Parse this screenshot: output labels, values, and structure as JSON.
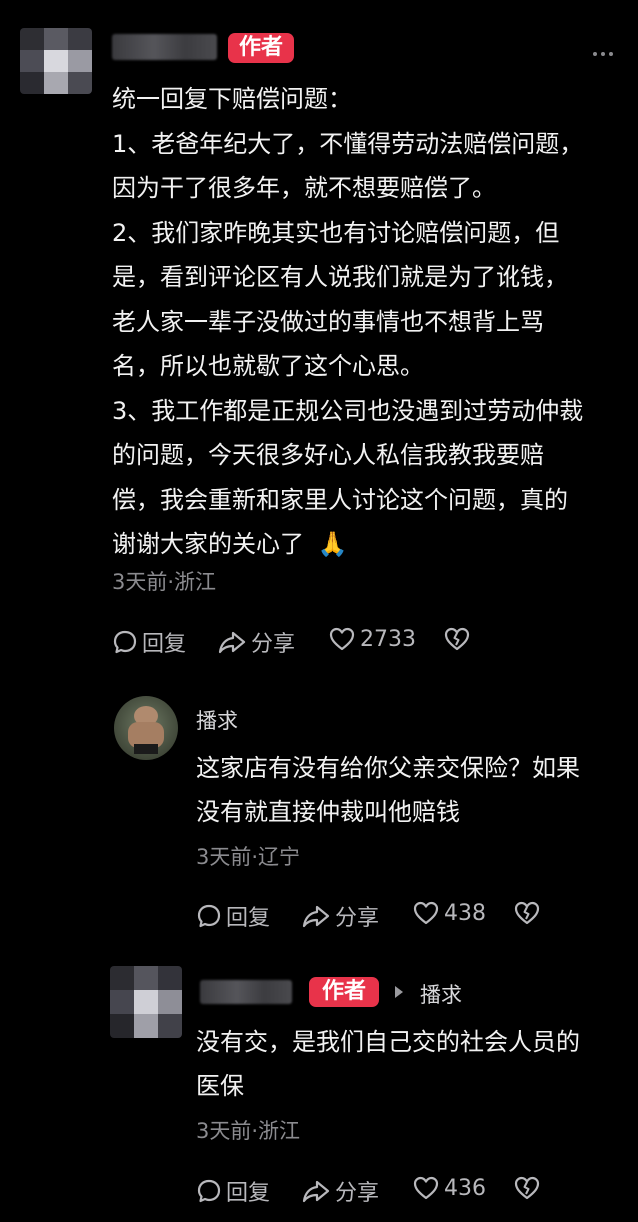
{
  "comment": {
    "author_badge": "作者",
    "lines": [
      "统一回复下赔偿问题：",
      "1、老爸年纪大了，不懂得劳动法赔偿问题，",
      "因为干了很多年，就不想要赔偿了。",
      "2、我们家昨晚其实也有讨论赔偿问题，但",
      "是，看到评论区有人说我们就是为了讹钱，",
      "老人家一辈子没做过的事情也不想背上骂",
      "名，所以也就歇了这个心思。",
      "3、我工作都是正规公司也没遇到过劳动仲裁",
      "的问题，今天很多好心人私信我教我要赔",
      "偿，我会重新和家里人讨论这个问题，真的",
      "谢谢大家的关心了"
    ],
    "emoji": "🙏",
    "meta": "3天前·浙江",
    "reply_label": "回复",
    "share_label": "分享",
    "like_count": "2733"
  },
  "replies": [
    {
      "name": "播求",
      "lines": [
        "这家店有没有给你父亲交保险？如果",
        "没有就直接仲裁叫他赔钱"
      ],
      "meta": "3天前·辽宁",
      "reply_label": "回复",
      "share_label": "分享",
      "like_count": "438"
    },
    {
      "author_badge": "作者",
      "reply_to": "播求",
      "lines": [
        "没有交，是我们自己交的社会人员的",
        "医保"
      ],
      "meta": "3天前·浙江",
      "reply_label": "回复",
      "share_label": "分享",
      "like_count": "436"
    }
  ],
  "colors": {
    "background": "#000000",
    "author_badge": "#e8334a",
    "meta_text": "#8b8b8f"
  },
  "icons": [
    "more-icon",
    "comment-icon",
    "share-icon",
    "heart-icon",
    "broken-heart-icon",
    "play-triangle-icon"
  ]
}
